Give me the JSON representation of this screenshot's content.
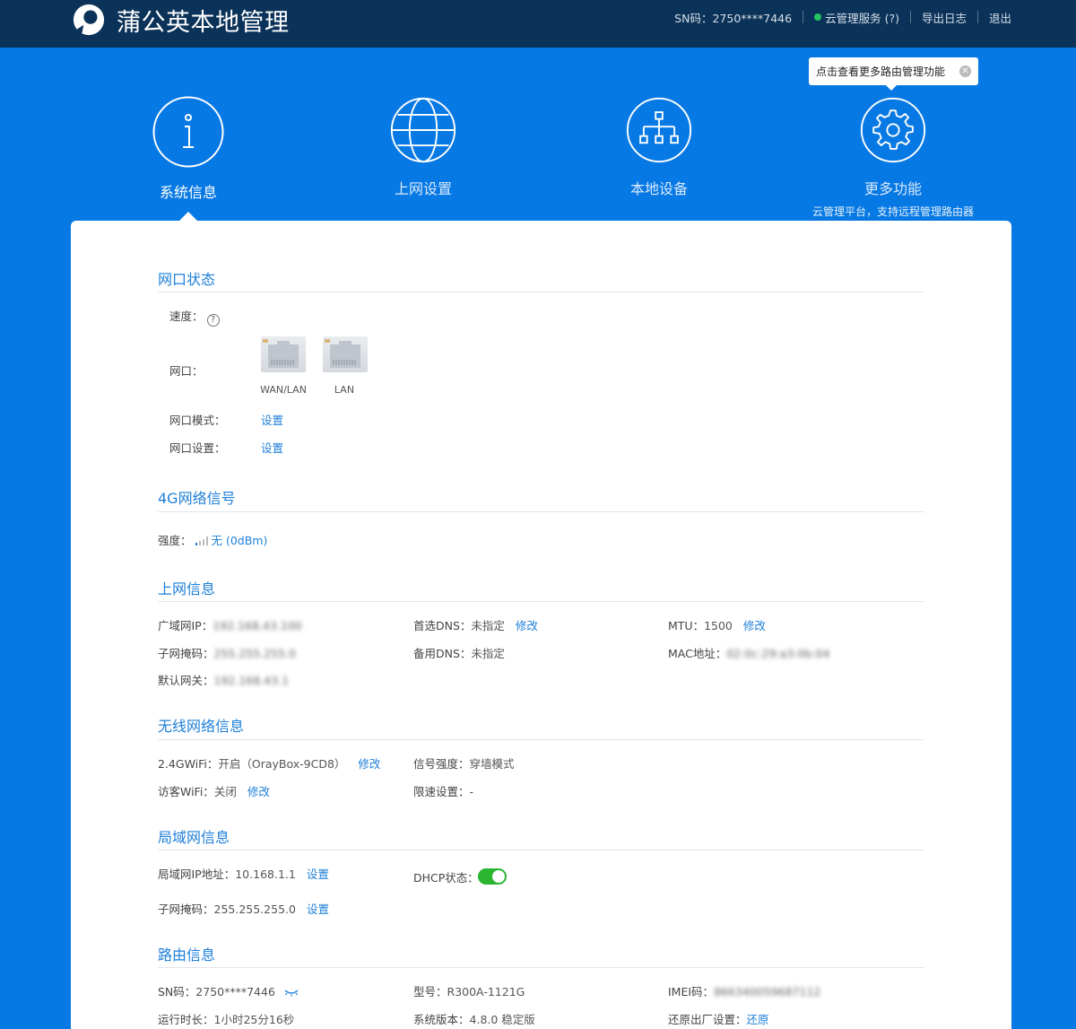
{
  "header": {
    "app_title": "蒲公英本地管理",
    "sn": "SN码：2750****7446",
    "cloud_service": "云管理服务 (?)",
    "export_log": "导出日志",
    "logout": "退出"
  },
  "tooltip": {
    "text": "点击查看更多路由管理功能"
  },
  "nav": {
    "items": [
      {
        "label": "系统信息",
        "icon": "info-icon"
      },
      {
        "label": "上网设置",
        "icon": "globe-icon"
      },
      {
        "label": "本地设备",
        "icon": "network-tree-icon"
      },
      {
        "label": "更多功能",
        "icon": "gear-icon",
        "sub": "云管理平台，支持远程管理路由器"
      }
    ]
  },
  "port_status": {
    "title": "网口状态",
    "speed_label": "速度：",
    "port_label": "网口：",
    "ports": [
      "WAN/LAN",
      "LAN"
    ],
    "mode_label": "网口模式：",
    "mode_link": "设置",
    "settings_label": "网口设置：",
    "settings_link": "设置"
  },
  "signal_4g": {
    "title": "4G网络信号",
    "strength_label": "强度：",
    "strength_value": "无 (0dBm)"
  },
  "internet_info": {
    "title": "上网信息",
    "wan_ip_label": "广域网IP：",
    "wan_ip_value": "192.168.43.100",
    "primary_dns_label": "首选DNS：",
    "primary_dns_value": "未指定",
    "primary_dns_link": "修改",
    "mtu_label": "MTU：",
    "mtu_value": "1500",
    "mtu_link": "修改",
    "subnet_label": "子网掩码：",
    "subnet_value": "255.255.255.0",
    "secondary_dns_label": "备用DNS：",
    "secondary_dns_value": "未指定",
    "mac_label": "MAC地址：",
    "mac_value": "02:0c:29:a3:0b:04",
    "gateway_label": "默认网关：",
    "gateway_value": "192.168.43.1"
  },
  "wireless_info": {
    "title": "无线网络信息",
    "wifi24_label": "2.4GWiFi：",
    "wifi24_value": "开启（OrayBox-9CD8）",
    "wifi24_link": "修改",
    "signal_label": "信号强度：",
    "signal_value": "穿墙模式",
    "guest_label": "访客WiFi：",
    "guest_value": "关闭",
    "guest_link": "修改",
    "limit_label": "限速设置：",
    "limit_value": "-"
  },
  "lan_info": {
    "title": "局域网信息",
    "lan_ip_label": "局域网IP地址：",
    "lan_ip_value": "10.168.1.1",
    "lan_ip_link": "设置",
    "dhcp_label": "DHCP状态：",
    "dhcp_on": true,
    "subnet_label": "子网掩码：",
    "subnet_value": "255.255.255.0",
    "subnet_link": "设置"
  },
  "router_info": {
    "title": "路由信息",
    "sn_label": "SN码：",
    "sn_value": "2750****7446",
    "model_label": "型号：",
    "model_value": "R300A-1121G",
    "imei_label": "IMEI码：",
    "imei_value": "866340059687112",
    "uptime_label": "运行时长：",
    "uptime_value": "1小时25分16秒",
    "version_label": "系统版本：",
    "version_value": "4.8.0 稳定版",
    "reset_label": "还原出厂设置：",
    "reset_link": "还原"
  },
  "colors": {
    "topbar": "#0b3258",
    "background": "#0779e4",
    "accent": "#1e7fd8",
    "toggle_on": "#2ab530"
  }
}
